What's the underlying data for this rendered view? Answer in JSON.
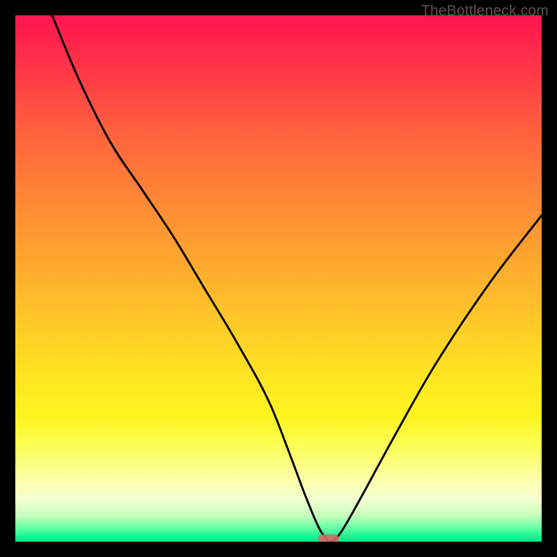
{
  "watermark": "TheBottleneck.com",
  "chart_data": {
    "type": "line",
    "title": "",
    "xlabel": "",
    "ylabel": "",
    "xlim": [
      0,
      100
    ],
    "ylim": [
      0,
      100
    ],
    "grid": false,
    "background": "rainbow-gradient-red-to-green-vertical",
    "series": [
      {
        "name": "bottleneck-curve",
        "x": [
          7,
          12,
          18,
          24,
          30,
          36,
          42,
          48,
          52,
          55,
          57.5,
          59,
          60,
          62,
          66,
          72,
          80,
          90,
          100
        ],
        "y": [
          100,
          88,
          76,
          67,
          58,
          48,
          38,
          27,
          17,
          9,
          3,
          0.7,
          0,
          2,
          9,
          20,
          34,
          49,
          62
        ]
      }
    ],
    "marker": {
      "name": "minimum",
      "x": 59.5,
      "y": 0.5,
      "color": "#d66a6a"
    },
    "annotations": []
  }
}
